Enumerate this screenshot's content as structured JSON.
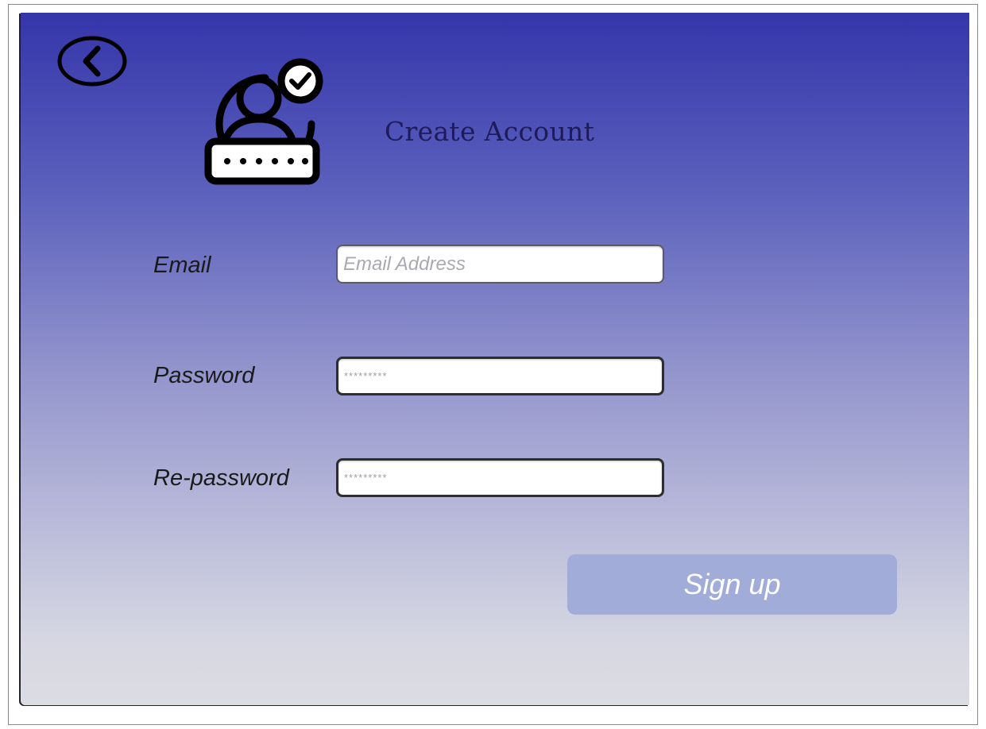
{
  "window": {
    "title": "Create Account"
  },
  "icons": {
    "back": "back-arrow-circle-icon",
    "logo": "verified-user-password-icon"
  },
  "form": {
    "email": {
      "label": "Email",
      "placeholder": "Email Address",
      "value": ""
    },
    "password": {
      "label": "Password",
      "placeholder": "*********",
      "value": ""
    },
    "repassword": {
      "label": "Re-password",
      "placeholder": "*********",
      "value": ""
    },
    "submit_label": "Sign up"
  },
  "colors": {
    "gradient_top": "#3535aa",
    "gradient_bottom": "#dcdde3",
    "title_text": "#1e1b5a",
    "button_bg": "#a1acd9",
    "button_text": "#ffffff"
  }
}
